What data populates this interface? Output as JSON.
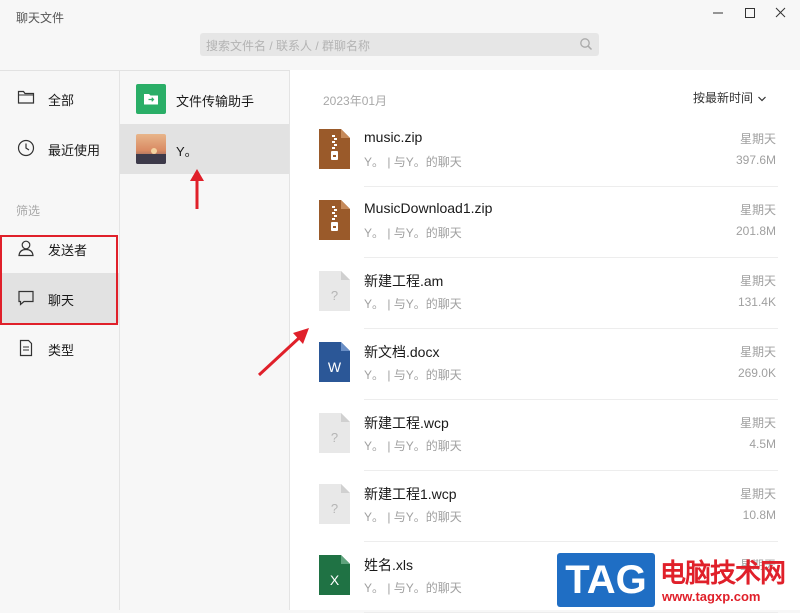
{
  "window": {
    "title": "聊天文件"
  },
  "search": {
    "placeholder": "搜索文件名 / 联系人 / 群聊名称"
  },
  "nav": {
    "all": "全部",
    "recent": "最近使用",
    "filter_label": "筛选",
    "sender": "发送者",
    "chat": "聊天",
    "type": "类型"
  },
  "chats": [
    {
      "name": "文件传输助手"
    },
    {
      "name": "Y。",
      "selected": true
    }
  ],
  "main": {
    "month": "2023年01月",
    "sort_label": "按最新时间"
  },
  "files": [
    {
      "name": "music.zip",
      "source": "Y。 | 与Y。的聊天",
      "day": "星期天",
      "size": "397.6M",
      "icon": "zip-file-icon"
    },
    {
      "name": "MusicDownload1.zip",
      "source": "Y。 | 与Y。的聊天",
      "day": "星期天",
      "size": "201.8M",
      "icon": "zip-file-icon"
    },
    {
      "name": "新建工程.am",
      "source": "Y。 | 与Y。的聊天",
      "day": "星期天",
      "size": "131.4K",
      "icon": "unknown-file-icon"
    },
    {
      "name": "新文档.docx",
      "source": "Y。 | 与Y。的聊天",
      "day": "星期天",
      "size": "269.0K",
      "icon": "word-file-icon"
    },
    {
      "name": "新建工程.wcp",
      "source": "Y。 | 与Y。的聊天",
      "day": "星期天",
      "size": "4.5M",
      "icon": "unknown-file-icon"
    },
    {
      "name": "新建工程1.wcp",
      "source": "Y。 | 与Y。的聊天",
      "day": "星期天",
      "size": "10.8M",
      "icon": "unknown-file-icon"
    },
    {
      "name": "姓名.xls",
      "source": "Y。 | 与Y。的聊天",
      "day": "星期天",
      "size": "",
      "icon": "excel-file-icon"
    }
  ],
  "watermark": {
    "brand": "TAG",
    "site_name": "电脑技术网",
    "url": "www.tagxp.com"
  },
  "colors": {
    "highlight_red": "#e0202a",
    "file_helper_green": "#2aae67",
    "zip_brown": "#9a5a2a",
    "word_blue": "#2b5797",
    "excel_green": "#1f7244"
  }
}
